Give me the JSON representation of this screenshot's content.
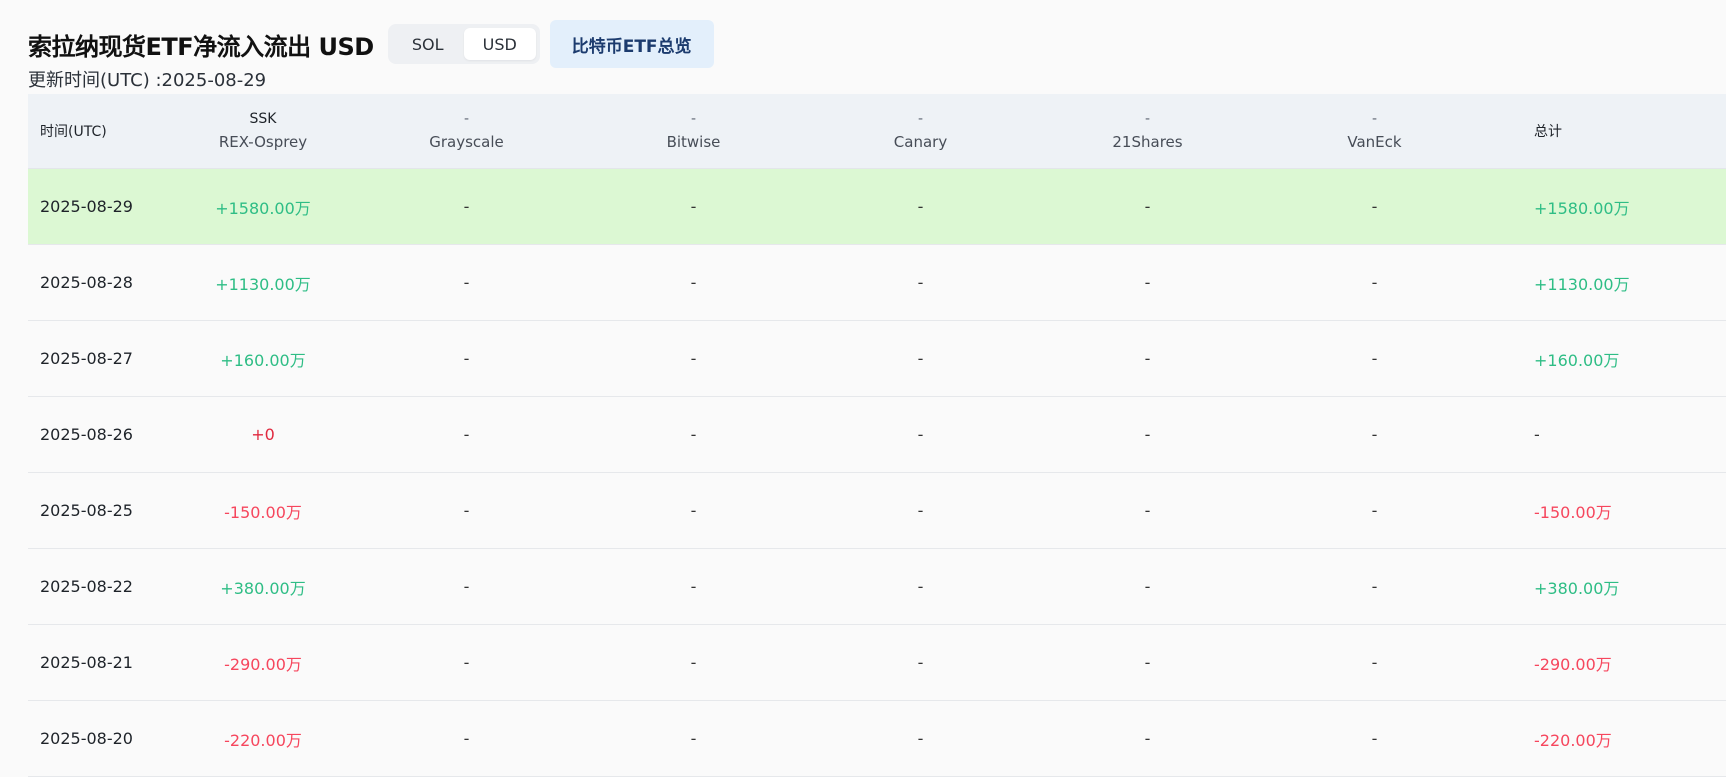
{
  "header": {
    "title": "索拉纳现货ETF净流入流出 USD",
    "unit_toggle": {
      "options": [
        "SOL",
        "USD"
      ],
      "selected": "USD"
    },
    "btc_overview_label": "比特币ETF总览",
    "updated_text": "更新时间(UTC) :2025-08-29"
  },
  "table": {
    "columns": [
      {
        "symbol": "",
        "name": "时间(UTC)"
      },
      {
        "symbol": "SSK",
        "name": "REX-Osprey"
      },
      {
        "symbol": "-",
        "name": "Grayscale"
      },
      {
        "symbol": "-",
        "name": "Bitwise"
      },
      {
        "symbol": "-",
        "name": "Canary"
      },
      {
        "symbol": "-",
        "name": "21Shares"
      },
      {
        "symbol": "-",
        "name": "VanEck"
      },
      {
        "symbol": "",
        "name": "总计"
      }
    ],
    "rows": [
      {
        "date": "2025-08-29",
        "ssk": "+1580.00万",
        "grayscale": "-",
        "bitwise": "-",
        "canary": "-",
        "shares21": "-",
        "vaneck": "-",
        "total": "+1580.00万",
        "highlight": true
      },
      {
        "date": "2025-08-28",
        "ssk": "+1130.00万",
        "grayscale": "-",
        "bitwise": "-",
        "canary": "-",
        "shares21": "-",
        "vaneck": "-",
        "total": "+1130.00万"
      },
      {
        "date": "2025-08-27",
        "ssk": "+160.00万",
        "grayscale": "-",
        "bitwise": "-",
        "canary": "-",
        "shares21": "-",
        "vaneck": "-",
        "total": "+160.00万"
      },
      {
        "date": "2025-08-26",
        "ssk": "+0",
        "grayscale": "-",
        "bitwise": "-",
        "canary": "-",
        "shares21": "-",
        "vaneck": "-",
        "total": "-"
      },
      {
        "date": "2025-08-25",
        "ssk": "-150.00万",
        "grayscale": "-",
        "bitwise": "-",
        "canary": "-",
        "shares21": "-",
        "vaneck": "-",
        "total": "-150.00万"
      },
      {
        "date": "2025-08-22",
        "ssk": "+380.00万",
        "grayscale": "-",
        "bitwise": "-",
        "canary": "-",
        "shares21": "-",
        "vaneck": "-",
        "total": "+380.00万"
      },
      {
        "date": "2025-08-21",
        "ssk": "-290.00万",
        "grayscale": "-",
        "bitwise": "-",
        "canary": "-",
        "shares21": "-",
        "vaneck": "-",
        "total": "-290.00万"
      },
      {
        "date": "2025-08-20",
        "ssk": "-220.00万",
        "grayscale": "-",
        "bitwise": "-",
        "canary": "-",
        "shares21": "-",
        "vaneck": "-",
        "total": "-220.00万"
      }
    ]
  },
  "colors": {
    "positive": "#2ebd85",
    "negative": "#f6465d",
    "highlight_row": "#dcf8d3",
    "header_bg": "#eef2f6",
    "button_bg": "#e3effb"
  }
}
